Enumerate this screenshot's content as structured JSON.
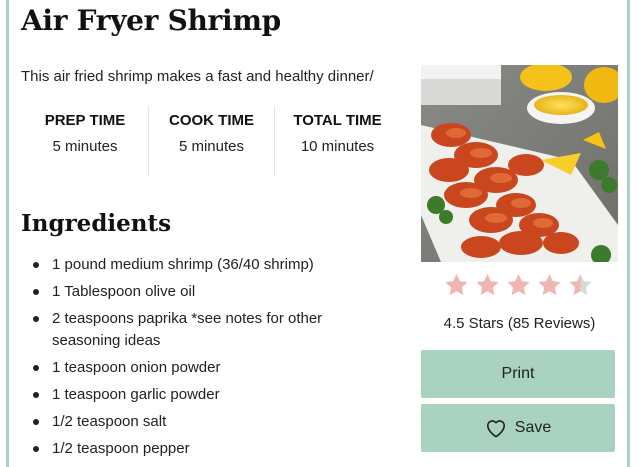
{
  "recipe": {
    "title": "Air Fryer Shrimp",
    "description": "This air fried shrimp makes a fast and healthy dinner/",
    "times": [
      {
        "label": "PREP TIME",
        "value": "5 minutes"
      },
      {
        "label": "COOK TIME",
        "value": "5 minutes"
      },
      {
        "label": "TOTAL TIME",
        "value": "10 minutes"
      }
    ],
    "ingredients_title": "Ingredients",
    "ingredients": [
      "1 pound medium shrimp (36/40 shrimp)",
      "1 Tablespoon olive oil",
      "2 teaspoons paprika *see notes for other seasoning ideas",
      "1 teaspoon onion powder",
      "1 teaspoon garlic powder",
      "1/2 teaspoon salt",
      "1/2 teaspoon pepper"
    ]
  },
  "rating": {
    "value": 4.5,
    "max": 5,
    "text": "4.5 Stars (85 Reviews)",
    "star_color": "#f0b7b2",
    "star_empty_color": "#d9d9d9"
  },
  "actions": {
    "print_label": "Print",
    "save_label": "Save",
    "save_icon": "heart-outline-icon"
  },
  "colors": {
    "accent": "#a9d2c1"
  }
}
